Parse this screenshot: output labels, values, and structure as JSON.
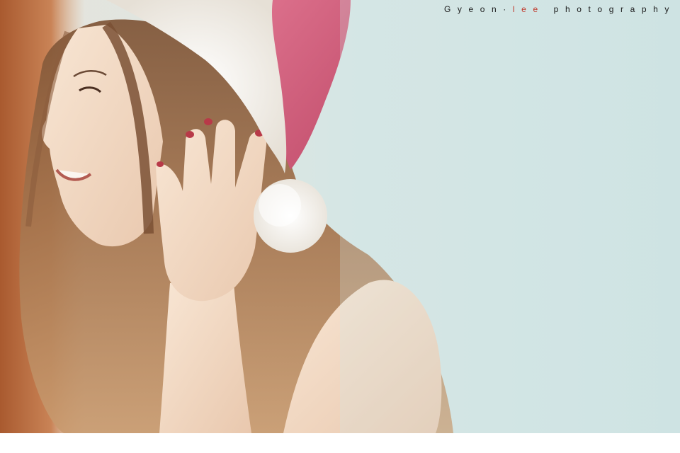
{
  "watermark": {
    "part1": "Gyeon",
    "separator": "·",
    "part2": "lee",
    "part3": "photography",
    "accent_color": "#c0392b",
    "text_color": "#1a1a1a"
  },
  "photo": {
    "background_color": "#cfe3e2",
    "hat_color": "#d4617e",
    "fur_color": "#f4f1ec",
    "hair_color": "#9a6a47",
    "skin_color": "#f4ddc8",
    "curtain_color": "#b86a3c"
  }
}
